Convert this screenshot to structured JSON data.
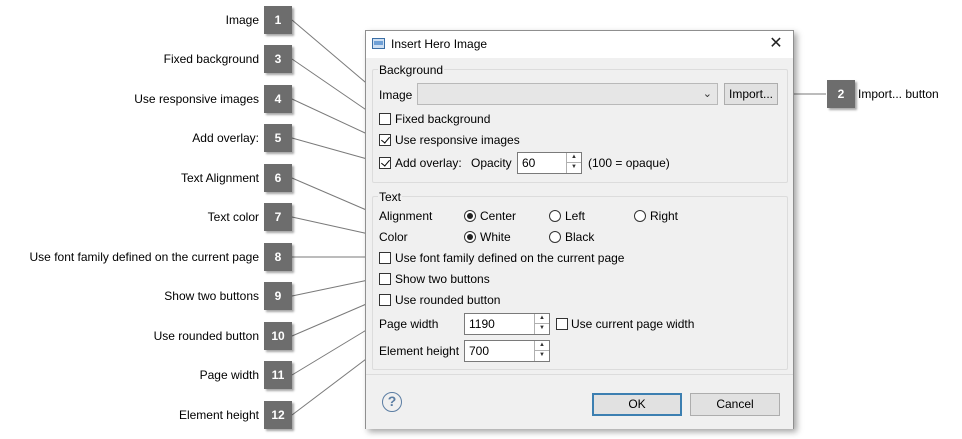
{
  "callouts_left": [
    {
      "num": "1",
      "label": "Image"
    },
    {
      "num": "3",
      "label": "Fixed background"
    },
    {
      "num": "4",
      "label": "Use responsive images"
    },
    {
      "num": "5",
      "label": "Add overlay:"
    },
    {
      "num": "6",
      "label": "Text Alignment"
    },
    {
      "num": "7",
      "label": "Text color"
    },
    {
      "num": "8",
      "label": "Use font family defined on the current page"
    },
    {
      "num": "9",
      "label": "Show two buttons"
    },
    {
      "num": "10",
      "label": "Use rounded button"
    },
    {
      "num": "11",
      "label": "Page width"
    },
    {
      "num": "12",
      "label": "Element height"
    }
  ],
  "callout_right": {
    "num": "2",
    "label": "Import... button"
  },
  "dialog": {
    "title": "Insert Hero Image",
    "close_glyph": "✕",
    "background_group": {
      "title": "Background",
      "image_label": "Image",
      "image_value": "",
      "import_label": "Import...",
      "fixed_background": {
        "label": "Fixed background",
        "checked": false
      },
      "responsive_images": {
        "label": "Use responsive images",
        "checked": true
      },
      "add_overlay": {
        "label": "Add overlay:",
        "checked": true
      },
      "opacity_label": "Opacity",
      "opacity_value": "60",
      "opacity_hint": "(100 = opaque)"
    },
    "text_group": {
      "title": "Text",
      "alignment_label": "Alignment",
      "alignment_options": [
        "Center",
        "Left",
        "Right"
      ],
      "alignment_selected": "Center",
      "color_label": "Color",
      "color_options": [
        "White",
        "Black"
      ],
      "color_selected": "White",
      "font_family": {
        "label": "Use font family defined on the current page",
        "checked": false
      },
      "two_buttons": {
        "label": "Show two buttons",
        "checked": false
      },
      "rounded_button": {
        "label": "Use rounded button",
        "checked": false
      },
      "page_width_label": "Page width",
      "page_width_value": "1190",
      "use_current_width": {
        "label": "Use current page width",
        "checked": false
      },
      "element_height_label": "Element height",
      "element_height_value": "700"
    },
    "footer": {
      "help_glyph": "?",
      "ok_label": "OK",
      "cancel_label": "Cancel"
    }
  },
  "colors": {
    "badge": "#6d6d6d",
    "dialog_bg": "#f0f0f0",
    "default_button_border": "#3c7fb1"
  }
}
